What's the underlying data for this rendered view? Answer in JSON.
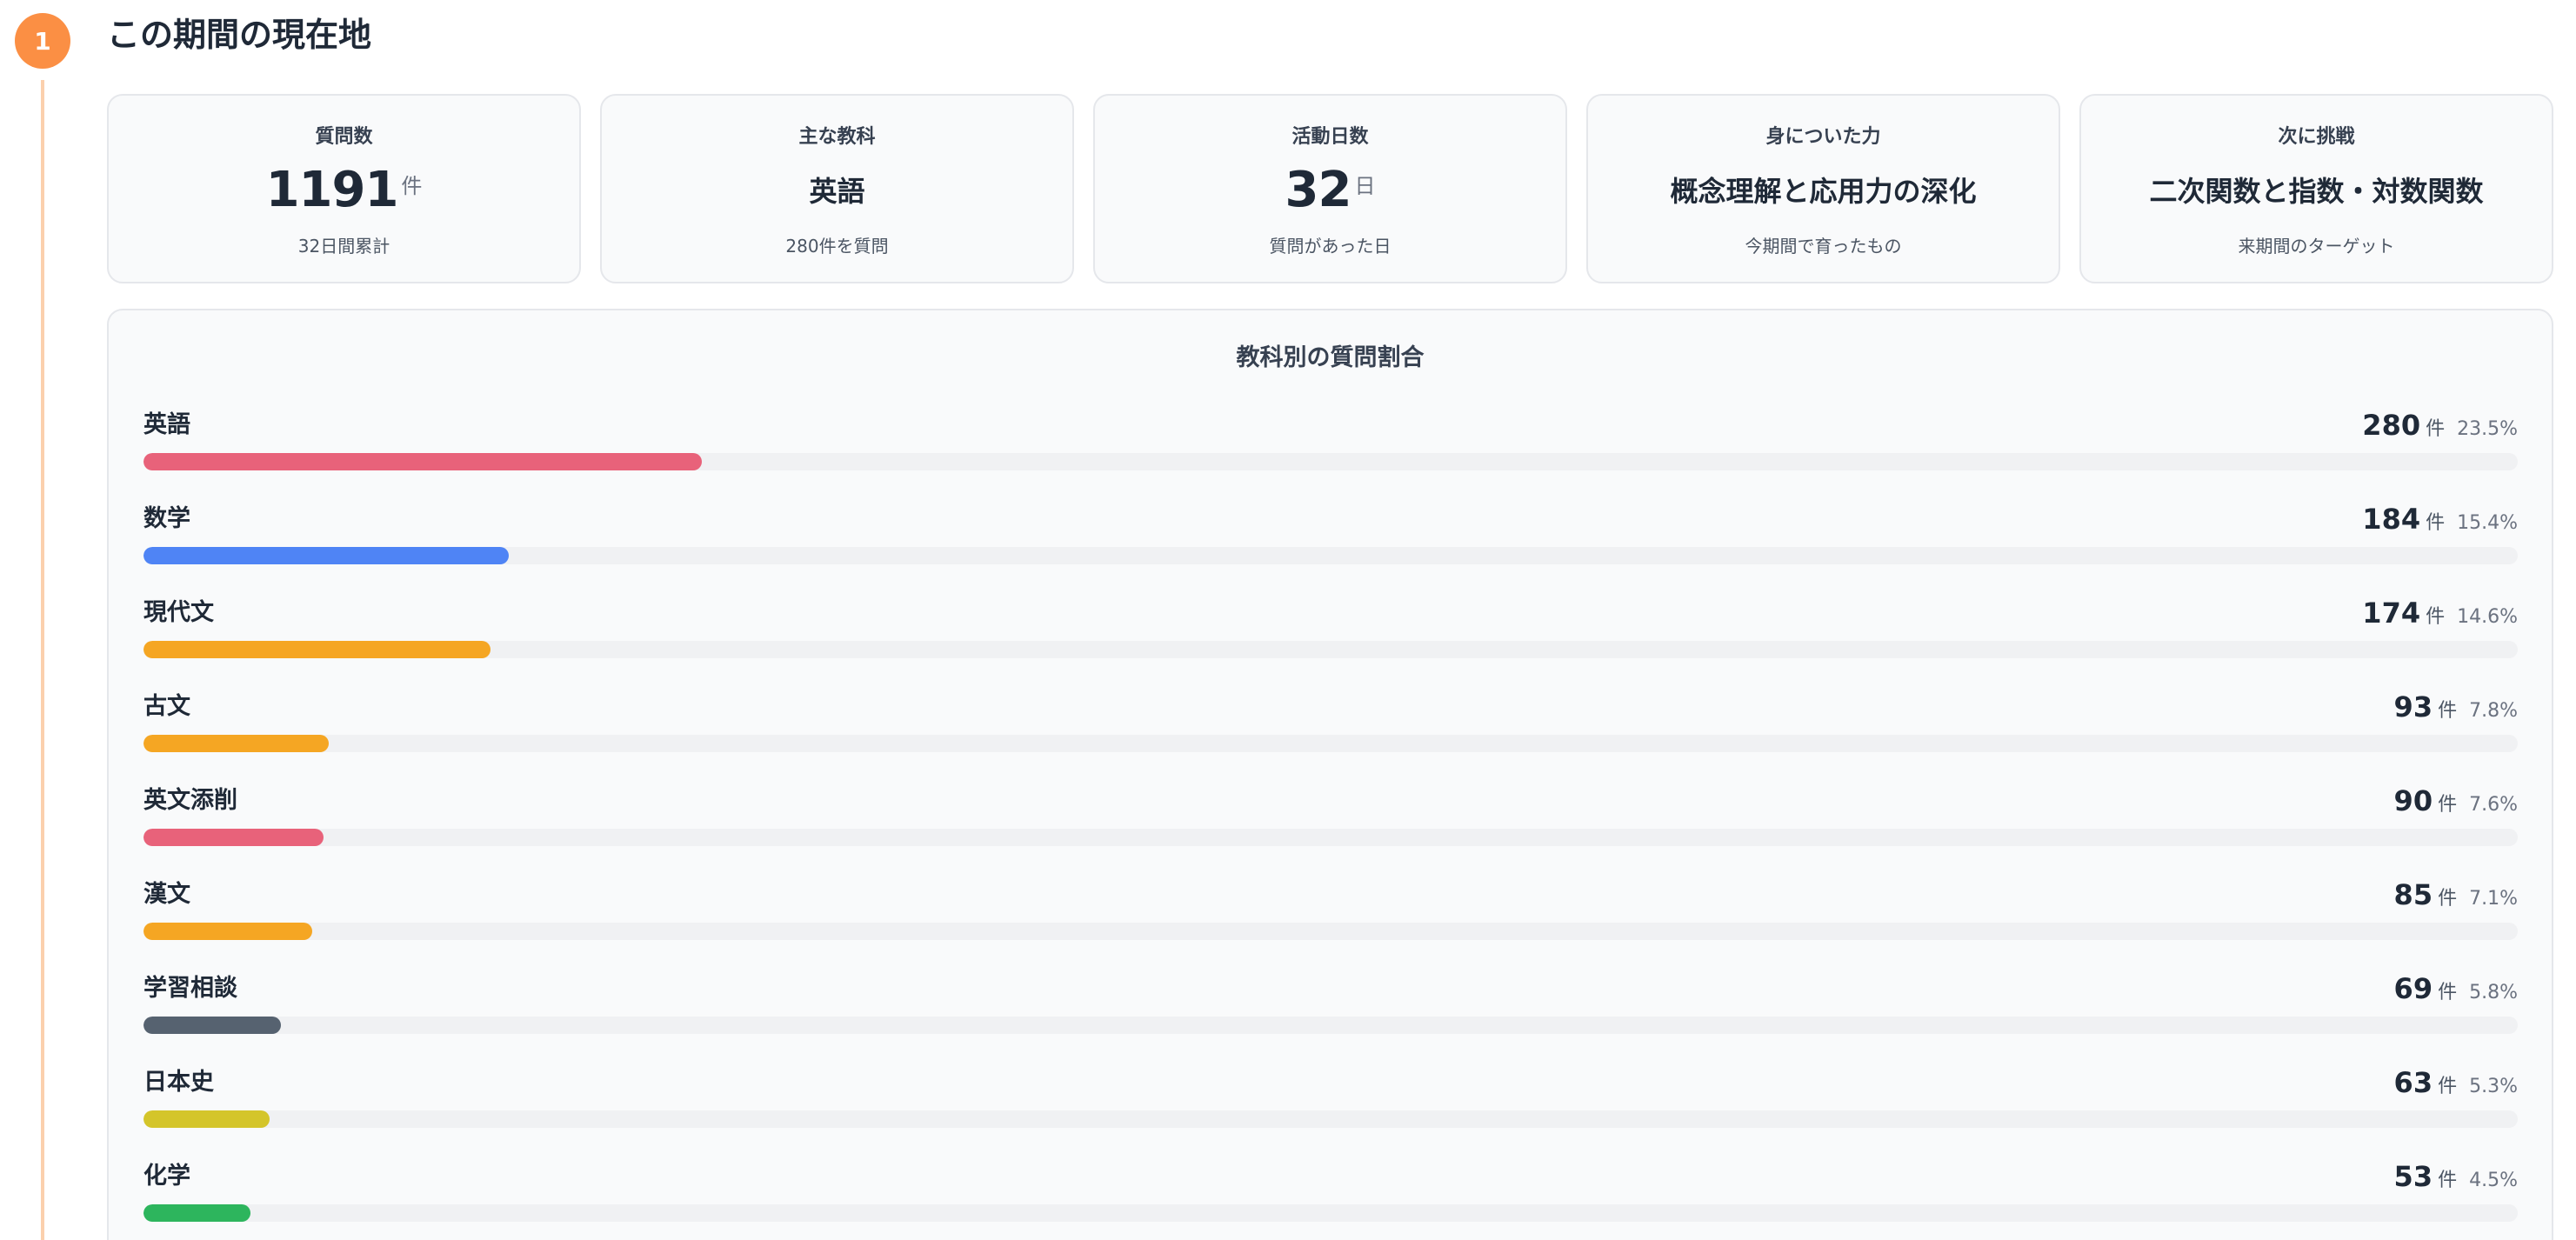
{
  "step": {
    "number": "1",
    "color": "#fb8f44"
  },
  "section_title": "この期間の現在地",
  "cards": [
    {
      "label": "質問数",
      "value": "1191",
      "unit": "件",
      "sub": "32日間累計",
      "type": "number"
    },
    {
      "label": "主な教科",
      "value": "英語",
      "sub": "280件を質問",
      "type": "text"
    },
    {
      "label": "活動日数",
      "value": "32",
      "unit": "日",
      "sub": "質問があった日",
      "type": "number"
    },
    {
      "label": "身についた力",
      "value": "概念理解と応用力の深化",
      "sub": "今期間で育ったもの",
      "type": "text"
    },
    {
      "label": "次に挑戦",
      "value": "二次関数と指数・対数関数",
      "sub": "来期間のターゲット",
      "type": "text"
    }
  ],
  "breakdown": {
    "title": "教科別の質問割合",
    "unit": "件",
    "subjects": [
      {
        "name": "英語",
        "count": "280",
        "pct": "23.5%",
        "fill": 0.235,
        "color": "#e8627a"
      },
      {
        "name": "数学",
        "count": "184",
        "pct": "15.4%",
        "fill": 0.154,
        "color": "#4f84f5"
      },
      {
        "name": "現代文",
        "count": "174",
        "pct": "14.6%",
        "fill": 0.146,
        "color": "#f5a623"
      },
      {
        "name": "古文",
        "count": "93",
        "pct": "7.8%",
        "fill": 0.078,
        "color": "#f5a623"
      },
      {
        "name": "英文添削",
        "count": "90",
        "pct": "7.6%",
        "fill": 0.076,
        "color": "#e8627a"
      },
      {
        "name": "漢文",
        "count": "85",
        "pct": "7.1%",
        "fill": 0.071,
        "color": "#f5a623"
      },
      {
        "name": "学習相談",
        "count": "69",
        "pct": "5.8%",
        "fill": 0.058,
        "color": "#566270"
      },
      {
        "name": "日本史",
        "count": "63",
        "pct": "5.3%",
        "fill": 0.053,
        "color": "#d4c52a"
      },
      {
        "name": "化学",
        "count": "53",
        "pct": "4.5%",
        "fill": 0.045,
        "color": "#2db55d"
      }
    ]
  }
}
